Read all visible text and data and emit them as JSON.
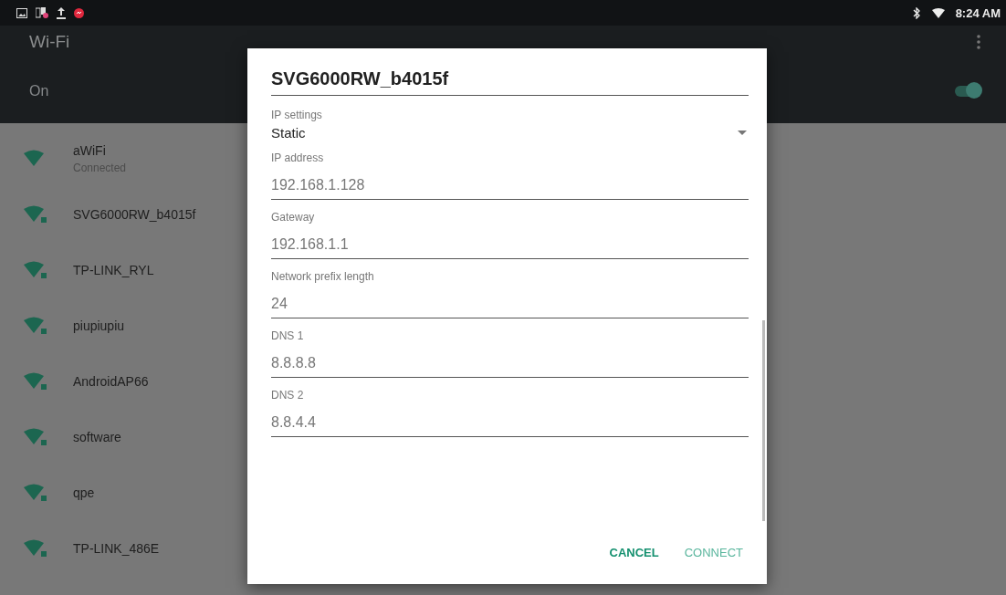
{
  "status_bar": {
    "time": "8:24 AM"
  },
  "header": {
    "title": "Wi-Fi",
    "switch_label": "On",
    "switch_on": true
  },
  "networks": [
    {
      "name": "aWiFi",
      "status": "Connected",
      "secured": false
    },
    {
      "name": "SVG6000RW_b4015f",
      "secured": true
    },
    {
      "name": "TP-LINK_RYL",
      "secured": true
    },
    {
      "name": "piupiupiu",
      "secured": true
    },
    {
      "name": "AndroidAP66",
      "secured": true
    },
    {
      "name": "software",
      "secured": true
    },
    {
      "name": "qpe",
      "secured": true
    },
    {
      "name": "TP-LINK_486E",
      "secured": true
    }
  ],
  "dialog": {
    "title": "SVG6000RW_b4015f",
    "ip_settings": {
      "label": "IP settings",
      "value": "Static"
    },
    "fields": [
      {
        "label": "IP address",
        "value": "192.168.1.128"
      },
      {
        "label": "Gateway",
        "value": "192.168.1.1"
      },
      {
        "label": "Network prefix length",
        "value": "24"
      },
      {
        "label": "DNS 1",
        "value": "8.8.8.8"
      },
      {
        "label": "DNS 2",
        "value": "8.8.4.4"
      }
    ],
    "buttons": [
      {
        "label": "CANCEL",
        "disabled": false
      },
      {
        "label": "CONNECT",
        "disabled": true
      }
    ]
  }
}
